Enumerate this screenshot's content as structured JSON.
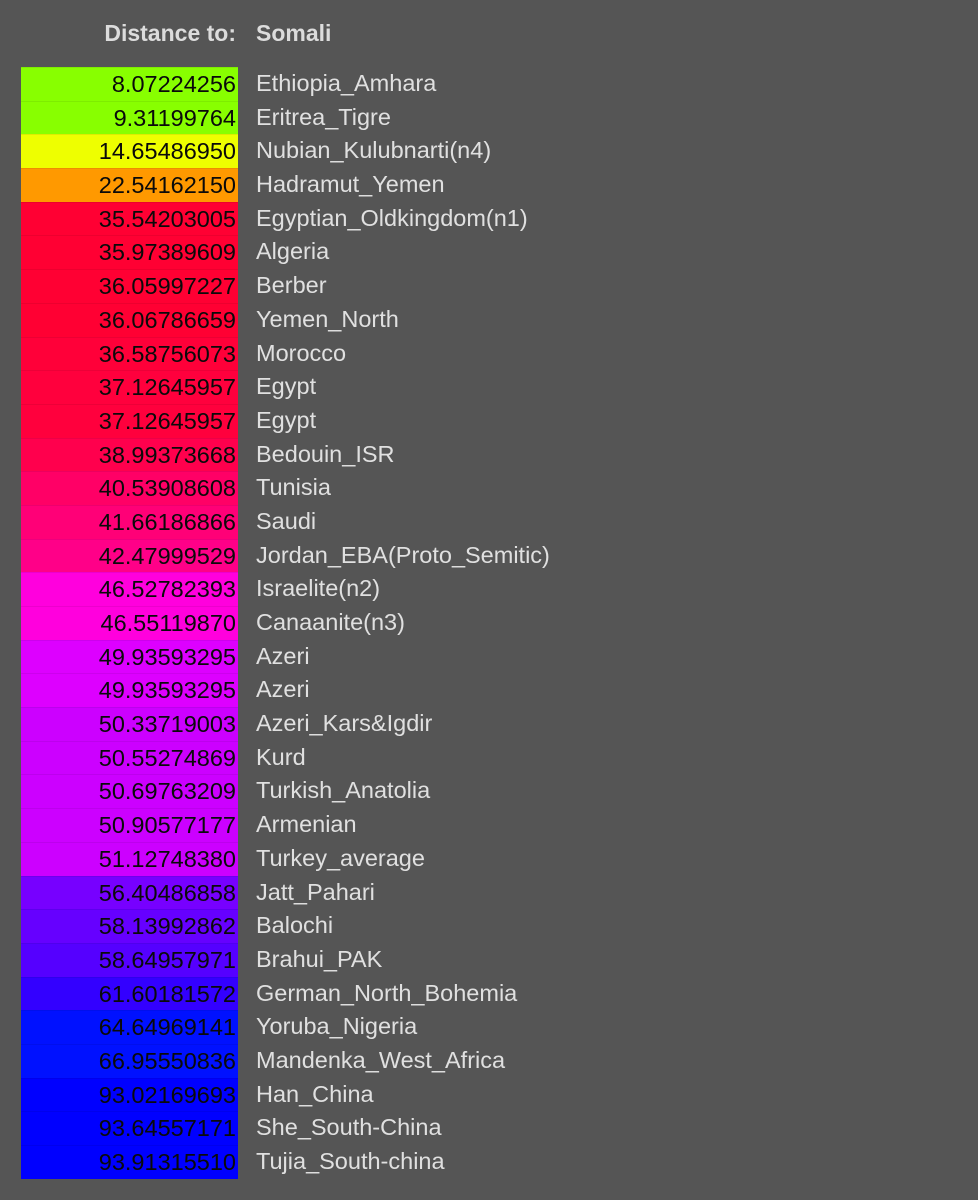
{
  "header": {
    "label": "Distance to:",
    "target": "Somali"
  },
  "rows": [
    {
      "value": "8.07224256",
      "name": "Ethiopia_Amhara",
      "color": "#88ff00"
    },
    {
      "value": "9.31199764",
      "name": "Eritrea_Tigre",
      "color": "#88ff00"
    },
    {
      "value": "14.65486950",
      "name": "Nubian_Kulubnarti(n4)",
      "color": "#eeff00"
    },
    {
      "value": "22.54162150",
      "name": "Hadramut_Yemen",
      "color": "#ff9900"
    },
    {
      "value": "35.54203005",
      "name": "Egyptian_Oldkingdom(n1)",
      "color": "#ff0033"
    },
    {
      "value": "35.97389609",
      "name": "Algeria",
      "color": "#ff0033"
    },
    {
      "value": "36.05997227",
      "name": "Berber",
      "color": "#ff0033"
    },
    {
      "value": "36.06786659",
      "name": "Yemen_North",
      "color": "#ff0033"
    },
    {
      "value": "36.58756073",
      "name": "Morocco",
      "color": "#ff0039"
    },
    {
      "value": "37.12645957",
      "name": "Egypt",
      "color": "#ff003d"
    },
    {
      "value": "37.12645957",
      "name": "Egypt",
      "color": "#ff003d"
    },
    {
      "value": "38.99373668",
      "name": "Bedouin_ISR",
      "color": "#ff004d"
    },
    {
      "value": "40.53908608",
      "name": "Tunisia",
      "color": "#ff0066"
    },
    {
      "value": "41.66186866",
      "name": "Saudi",
      "color": "#ff0077"
    },
    {
      "value": "42.47999529",
      "name": "Jordan_EBA(Proto_Semitic)",
      "color": "#ff0088"
    },
    {
      "value": "46.52782393",
      "name": "Israelite(n2)",
      "color": "#ff00dd"
    },
    {
      "value": "46.55119870",
      "name": "Canaanite(n3)",
      "color": "#ff00dd"
    },
    {
      "value": "49.93593295",
      "name": "Azeri",
      "color": "#dd00ff"
    },
    {
      "value": "49.93593295",
      "name": "Azeri",
      "color": "#dd00ff"
    },
    {
      "value": "50.33719003",
      "name": "Azeri_Kars&Igdir",
      "color": "#cc00ff"
    },
    {
      "value": "50.55274869",
      "name": "Kurd",
      "color": "#cc00ff"
    },
    {
      "value": "50.69763209",
      "name": "Turkish_Anatolia",
      "color": "#cc00ff"
    },
    {
      "value": "50.90577177",
      "name": "Armenian",
      "color": "#cc00ff"
    },
    {
      "value": "51.12748380",
      "name": "Turkey_average",
      "color": "#cc00ff"
    },
    {
      "value": "56.40486858",
      "name": "Jatt_Pahari",
      "color": "#7700ff"
    },
    {
      "value": "58.13992862",
      "name": "Balochi",
      "color": "#6600ff"
    },
    {
      "value": "58.64957971",
      "name": "Brahui_PAK",
      "color": "#5500ff"
    },
    {
      "value": "61.60181572",
      "name": "German_North_Bohemia",
      "color": "#3300ff"
    },
    {
      "value": "64.64969141",
      "name": "Yoruba_Nigeria",
      "color": "#0011ff"
    },
    {
      "value": "66.95550836",
      "name": "Mandenka_West_Africa",
      "color": "#0011ff"
    },
    {
      "value": "93.02169693",
      "name": "Han_China",
      "color": "#0000ff"
    },
    {
      "value": "93.64557171",
      "name": "She_South-China",
      "color": "#0000ff"
    },
    {
      "value": "93.91315510",
      "name": "Tujia_South-china",
      "color": "#0000ff"
    }
  ]
}
